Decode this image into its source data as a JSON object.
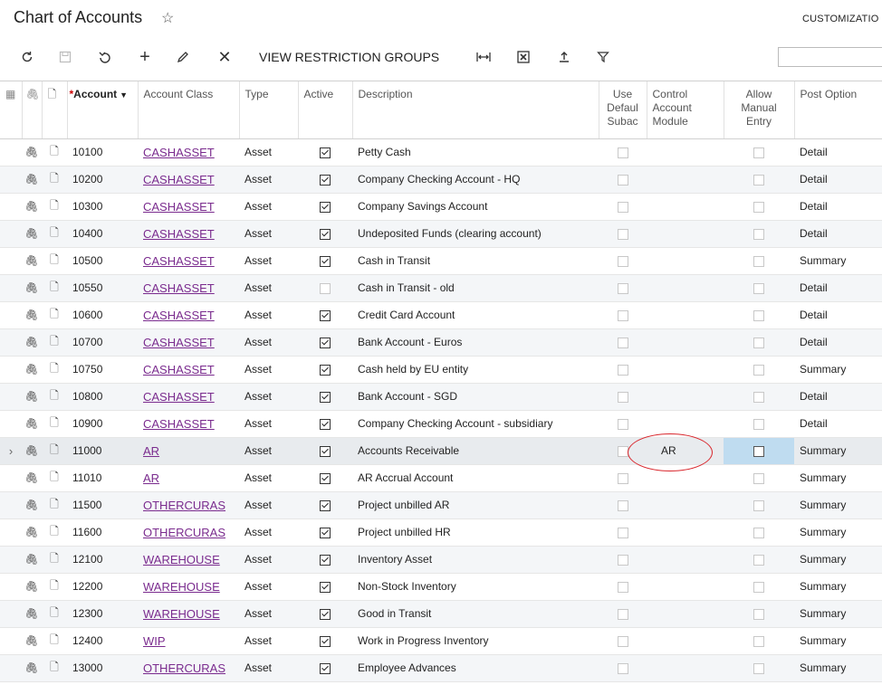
{
  "page": {
    "title": "Chart of Accounts",
    "customization_label": "CUSTOMIZATIO"
  },
  "toolbar": {
    "view_restriction_groups": "VIEW RESTRICTION GROUPS",
    "search_placeholder": ""
  },
  "columns": {
    "account": "Account",
    "account_required": "*",
    "account_class": "Account Class",
    "type": "Type",
    "active": "Active",
    "description": "Description",
    "use_default_subacc": "Use Defaul Subac",
    "control_account_module": "Control Account Module",
    "allow_manual_entry": "Allow Manual Entry",
    "post_option": "Post Option"
  },
  "rows": [
    {
      "account": "10100",
      "account_class": "CASHASSET",
      "type": "Asset",
      "active": true,
      "description": "Petty Cash",
      "control": "",
      "post_option": "Detail"
    },
    {
      "account": "10200",
      "account_class": "CASHASSET",
      "type": "Asset",
      "active": true,
      "description": "Company Checking Account - HQ",
      "control": "",
      "post_option": "Detail"
    },
    {
      "account": "10300",
      "account_class": "CASHASSET",
      "type": "Asset",
      "active": true,
      "description": "Company Savings Account",
      "control": "",
      "post_option": "Detail"
    },
    {
      "account": "10400",
      "account_class": "CASHASSET",
      "type": "Asset",
      "active": true,
      "description": "Undeposited Funds (clearing account)",
      "control": "",
      "post_option": "Detail"
    },
    {
      "account": "10500",
      "account_class": "CASHASSET",
      "type": "Asset",
      "active": true,
      "description": "Cash in Transit",
      "control": "",
      "post_option": "Summary"
    },
    {
      "account": "10550",
      "account_class": "CASHASSET",
      "type": "Asset",
      "active": false,
      "description": "Cash in Transit - old",
      "control": "",
      "post_option": "Detail"
    },
    {
      "account": "10600",
      "account_class": "CASHASSET",
      "type": "Asset",
      "active": true,
      "description": "Credit Card Account",
      "control": "",
      "post_option": "Detail"
    },
    {
      "account": "10700",
      "account_class": "CASHASSET",
      "type": "Asset",
      "active": true,
      "description": "Bank Account - Euros",
      "control": "",
      "post_option": "Detail"
    },
    {
      "account": "10750",
      "account_class": "CASHASSET",
      "type": "Asset",
      "active": true,
      "description": "Cash held by EU entity",
      "control": "",
      "post_option": "Summary"
    },
    {
      "account": "10800",
      "account_class": "CASHASSET",
      "type": "Asset",
      "active": true,
      "description": "Bank Account - SGD",
      "control": "",
      "post_option": "Detail"
    },
    {
      "account": "10900",
      "account_class": "CASHASSET",
      "type": "Asset",
      "active": true,
      "description": "Company Checking Account - subsidiary",
      "control": "",
      "post_option": "Detail"
    },
    {
      "account": "11000",
      "account_class": "AR",
      "type": "Asset",
      "active": true,
      "description": "Accounts Receivable",
      "control": "AR",
      "post_option": "Summary",
      "selected": true
    },
    {
      "account": "11010",
      "account_class": "AR",
      "type": "Asset",
      "active": true,
      "description": "AR Accrual Account",
      "control": "",
      "post_option": "Summary"
    },
    {
      "account": "11500",
      "account_class": "OTHERCURAS",
      "type": "Asset",
      "active": true,
      "description": "Project unbilled AR",
      "control": "",
      "post_option": "Summary"
    },
    {
      "account": "11600",
      "account_class": "OTHERCURAS",
      "type": "Asset",
      "active": true,
      "description": "Project unbilled HR",
      "control": "",
      "post_option": "Summary"
    },
    {
      "account": "12100",
      "account_class": "WAREHOUSE",
      "type": "Asset",
      "active": true,
      "description": "Inventory Asset",
      "control": "",
      "post_option": "Summary"
    },
    {
      "account": "12200",
      "account_class": "WAREHOUSE",
      "type": "Asset",
      "active": true,
      "description": "Non-Stock Inventory",
      "control": "",
      "post_option": "Summary"
    },
    {
      "account": "12300",
      "account_class": "WAREHOUSE",
      "type": "Asset",
      "active": true,
      "description": "Good in Transit",
      "control": "",
      "post_option": "Summary"
    },
    {
      "account": "12400",
      "account_class": "WIP",
      "type": "Asset",
      "active": true,
      "description": "Work in Progress Inventory",
      "control": "",
      "post_option": "Summary"
    },
    {
      "account": "13000",
      "account_class": "OTHERCURAS",
      "type": "Asset",
      "active": true,
      "description": "Employee Advances",
      "control": "",
      "post_option": "Summary"
    }
  ],
  "colors": {
    "link": "#7a2b8e",
    "highlight_cell": "#bfdcf0",
    "annotation_circle": "#d9262c"
  }
}
